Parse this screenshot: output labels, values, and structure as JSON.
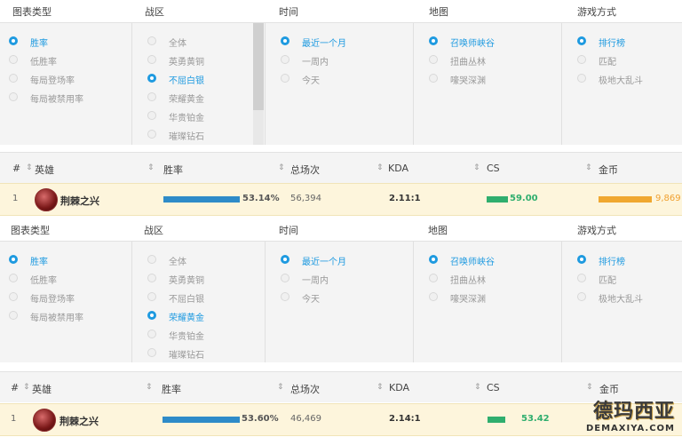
{
  "headers": {
    "chart_type": "图表类型",
    "region": "战区",
    "time": "时间",
    "map": "地图",
    "mode": "游戏方式"
  },
  "panels": [
    {
      "chart_type": [
        "胜率",
        "低胜率",
        "每局登场率",
        "每局被禁用率"
      ],
      "region": [
        "全体",
        "英勇黄铜",
        "不屈白银",
        "荣耀黄金",
        "华贵铂金",
        "璀璨钻石"
      ],
      "time": [
        "最近一个月",
        "一周内",
        "今天"
      ],
      "map": [
        "召唤师峡谷",
        "扭曲丛林",
        "嚎哭深渊"
      ],
      "mode": [
        "排行榜",
        "匹配",
        "极地大乱斗"
      ],
      "selected_region": "不屈白银",
      "table": {
        "cols": [
          "#",
          "英雄",
          "胜率",
          "总场次",
          "KDA",
          "CS",
          "金币"
        ],
        "row": {
          "rank": "1",
          "hero": "荆棘之兴",
          "winrate": "53.14%",
          "winrate_frac": 0.5314,
          "games": "56,394",
          "kda": "2.11:1",
          "cs": "59.00",
          "gold": "9,869"
        }
      }
    },
    {
      "chart_type": [
        "胜率",
        "低胜率",
        "每局登场率",
        "每局被禁用率"
      ],
      "region": [
        "全体",
        "英勇黄铜",
        "不屈白银",
        "荣耀黄金",
        "华贵铂金",
        "璀璨钻石"
      ],
      "time": [
        "最近一个月",
        "一周内",
        "今天"
      ],
      "map": [
        "召唤师峡谷",
        "扭曲丛林",
        "嚎哭深渊"
      ],
      "mode": [
        "排行榜",
        "匹配",
        "极地大乱斗"
      ],
      "selected_region": "荣耀黄金",
      "table": {
        "cols": [
          "#",
          "英雄",
          "胜率",
          "总场次",
          "KDA",
          "CS",
          "金币"
        ],
        "row": {
          "rank": "1",
          "hero": "荆棘之兴",
          "winrate": "53.60%",
          "winrate_frac": 0.536,
          "games": "46,469",
          "kda": "2.14:1",
          "cs": "53.42",
          "gold": ""
        }
      }
    }
  ],
  "colors": {
    "accent": "#1e9ae0",
    "winrate_bar": "#2e8bc8",
    "cs_bar": "#2fae6e",
    "gold_bar": "#f0a830",
    "gold_text": "#f0a030",
    "cs_text": "#2fae6e"
  },
  "watermark": {
    "cn": "德玛西亚",
    "en": "DEMAXIYA.COM"
  }
}
